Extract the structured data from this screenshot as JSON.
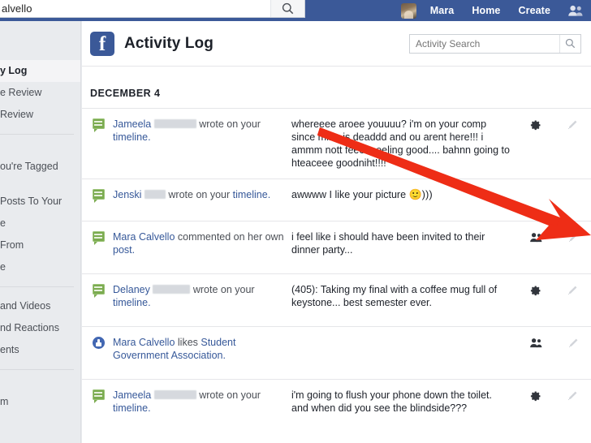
{
  "topbar": {
    "search_value": "alvello",
    "search_icon": "search-icon",
    "user_name": "Mara",
    "home_label": "Home",
    "create_label": "Create",
    "avatar_icon": "avatar",
    "profile_icon": "friends-icon",
    "bg_color": "#3b5998"
  },
  "header": {
    "logo_letter": "f",
    "title": "Activity Log",
    "search_placeholder": "Activity Search",
    "search_value": "",
    "search_icon": "search-icon"
  },
  "sidebar": {
    "items": [
      {
        "label": "y Log",
        "active": true
      },
      {
        "label": "e Review",
        "active": false
      },
      {
        "label": "Review",
        "active": false
      },
      {
        "label": "ou're Tagged",
        "active": false
      },
      {
        "label": "Posts To Your",
        "active": false
      },
      {
        "label": "e",
        "active": false
      },
      {
        "label": "From",
        "active": false
      },
      {
        "label": "e",
        "active": false
      },
      {
        "label": "and Videos",
        "active": false
      },
      {
        "label": "nd Reactions",
        "active": false
      },
      {
        "label": "ents",
        "active": false
      },
      {
        "label": "m",
        "active": false
      }
    ]
  },
  "main": {
    "date_header": "DECEMBER 4",
    "rows": [
      {
        "icon": "comment-icon",
        "actor": "Jameela",
        "redacted": true,
        "redact_width": 52,
        "action_before": "wrote on your ",
        "action_link": "timeline.",
        "body": "whereeee aroee youuuu? i'm on your comp since mine is deaddd and ou arent here!!! i ammm nott feeeeeeeling good.... bahnn going to hteaceee goodniht!!!!",
        "emoji": "",
        "audience_icon": "gear-icon",
        "edit_icon": "pencil-icon"
      },
      {
        "icon": "comment-icon",
        "actor": "Jenski",
        "redacted": true,
        "redact_width": 26,
        "action_before": "wrote on your ",
        "action_link": "timeline.",
        "body": "awwww I like your picture ",
        "emoji": "🙂)))",
        "audience_icon": "",
        "edit_icon": ""
      },
      {
        "icon": "comment-icon",
        "actor": "Mara Calvello",
        "redacted": false,
        "redact_width": 0,
        "action_before": " commented on her own ",
        "action_link": "post.",
        "body": "i feel like i should have been invited to their dinner party...",
        "emoji": "",
        "audience_icon": "friends-icon",
        "edit_icon": "pencil-icon"
      },
      {
        "icon": "comment-icon",
        "actor": "Delaney",
        "redacted": true,
        "redact_width": 46,
        "action_before": "wrote on your ",
        "action_link": "timeline.",
        "body": "(405): Taking my final with a coffee mug full of keystone... best semester ever.",
        "emoji": "",
        "audience_icon": "gear-icon",
        "edit_icon": "pencil-icon"
      },
      {
        "icon": "like-icon",
        "actor": "Mara Calvello",
        "redacted": false,
        "redact_width": 0,
        "action_before": " likes ",
        "action_link": "Student Government Association.",
        "body": "",
        "emoji": "",
        "audience_icon": "friends-icon",
        "edit_icon": "pencil-icon"
      },
      {
        "icon": "comment-icon",
        "actor": "Jameela",
        "redacted": true,
        "redact_width": 52,
        "action_before": "wrote on your ",
        "action_link": "timeline.",
        "body": "i'm going to flush your phone down the toilet. and when did you see the blindside???",
        "emoji": "",
        "audience_icon": "gear-icon",
        "edit_icon": "pencil-icon"
      }
    ]
  },
  "annotation": {
    "arrow_color": "#ee2d16",
    "arrow_name": "red-annotation-arrow"
  }
}
